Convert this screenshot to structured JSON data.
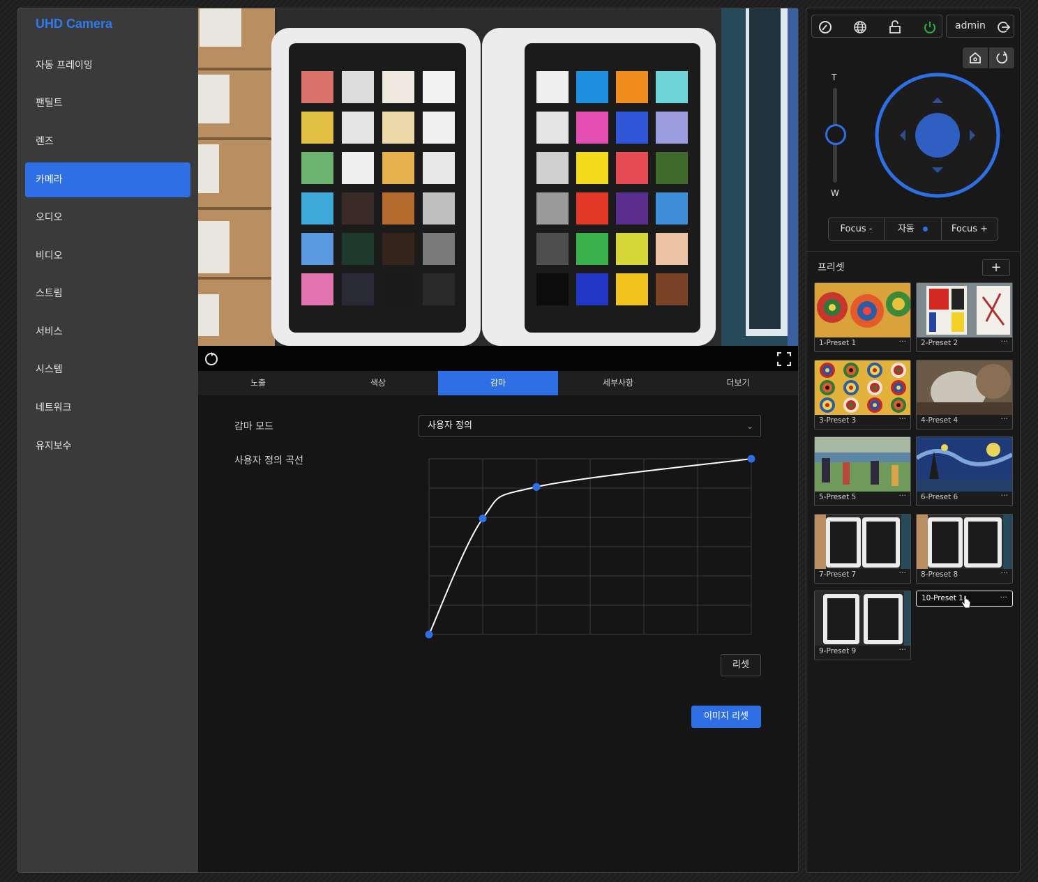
{
  "app": {
    "brand": "UHD Camera"
  },
  "sidebar": {
    "items": [
      {
        "label": "자동 프레이밍",
        "active": false
      },
      {
        "label": "팬틸트",
        "active": false
      },
      {
        "label": "렌즈",
        "active": false
      },
      {
        "label": "카메라",
        "active": true
      },
      {
        "label": "오디오",
        "active": false
      },
      {
        "label": "비디오",
        "active": false
      },
      {
        "label": "스트림",
        "active": false
      },
      {
        "label": "서비스",
        "active": false
      },
      {
        "label": "시스템",
        "active": false
      },
      {
        "label": "네트워크",
        "active": false
      },
      {
        "label": "유지보수",
        "active": false
      }
    ]
  },
  "tabs": [
    {
      "label": "노출",
      "active": false
    },
    {
      "label": "색상",
      "active": false
    },
    {
      "label": "감마",
      "active": true
    },
    {
      "label": "세부사항",
      "active": false
    },
    {
      "label": "더보기",
      "active": false
    }
  ],
  "gamma": {
    "mode_label": "감마 모드",
    "mode_value": "사용자 정의",
    "curve_label": "사용자 정의 곡선",
    "curve_points": [
      [
        0,
        0
      ],
      [
        1,
        0.66
      ],
      [
        2,
        0.84
      ],
      [
        6,
        1.0
      ]
    ],
    "grid_cols": 6,
    "grid_rows": 6,
    "reset_label": "리셋",
    "image_reset_label": "이미지 리셋"
  },
  "toolbar": {
    "user": "admin"
  },
  "ptz": {
    "tele_label": "T",
    "wide_label": "W"
  },
  "focus": {
    "minus_label": "Focus -",
    "auto_label": "자동",
    "plus_label": "Focus +"
  },
  "presets": {
    "title": "프리셋",
    "more": "···",
    "items": [
      {
        "label": "1-Preset 1"
      },
      {
        "label": "2-Preset 2"
      },
      {
        "label": "3-Preset 3"
      },
      {
        "label": "4-Preset 4"
      },
      {
        "label": "5-Preset 5"
      },
      {
        "label": "6-Preset 6"
      },
      {
        "label": "7-Preset 7"
      },
      {
        "label": "8-Preset 8"
      },
      {
        "label": "9-Preset 9"
      }
    ],
    "editing_value": "10-Preset 1"
  },
  "colors": {
    "accent": "#2f6fe6",
    "power": "#27b53a"
  }
}
